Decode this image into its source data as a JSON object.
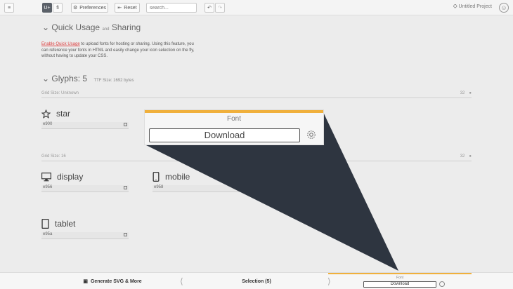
{
  "toolbar": {
    "menu_icon": "hamburger-icon",
    "ligature_label": "U+",
    "fi_label": "fi",
    "preferences_label": "Preferences",
    "reset_label": "Reset",
    "search_placeholder": "search...",
    "project_name": "Untitled Project"
  },
  "quick_usage": {
    "title": "Quick Usage",
    "and": "and",
    "sharing": "Sharing",
    "link": "Enable Quick Usage",
    "text": " to upload fonts for hosting or sharing. Using this feature, you can reference your fonts in HTML and easily change your icon selection on the fly, without having to update your CSS."
  },
  "glyphs": {
    "title": "Glyphs: 5",
    "ttf_size": "TTF Size: 1692 bytes"
  },
  "grid1": {
    "label": "Grid Size: Unknown",
    "size": "32"
  },
  "grid2": {
    "label": "Grid Size: 16",
    "size": "32"
  },
  "items": [
    {
      "name": "star",
      "code": "e900",
      "icon": "star-icon"
    },
    {
      "name": "display",
      "code": "e956",
      "icon": "monitor-icon"
    },
    {
      "name": "mobile",
      "code": "e958",
      "icon": "mobile-icon"
    },
    {
      "name": "tablet",
      "code": "e95a",
      "icon": "tablet-icon"
    }
  ],
  "zoom": {
    "font_label": "Font",
    "download_label": "Download"
  },
  "bottom": {
    "generate_label": "Generate SVG & More",
    "selection_label": "Selection (5)",
    "font_label": "Font",
    "download_label": "Download"
  },
  "colors": {
    "accent": "#f0b03c",
    "link": "#dd4444",
    "beam": "#2e3540"
  }
}
